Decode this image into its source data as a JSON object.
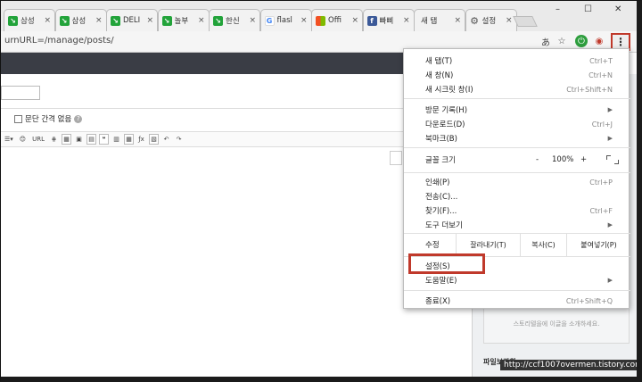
{
  "tabs": [
    {
      "title": "삼성",
      "icon": "green"
    },
    {
      "title": "삼성",
      "icon": "green"
    },
    {
      "title": "DELI",
      "icon": "green"
    },
    {
      "title": "놀부",
      "icon": "green"
    },
    {
      "title": "한신",
      "icon": "green"
    },
    {
      "title": "flasl",
      "icon": "g"
    },
    {
      "title": "Offi",
      "icon": "ms"
    },
    {
      "title": "빠삐",
      "icon": "fb"
    },
    {
      "title": "새 탭",
      "icon": "none"
    },
    {
      "title": "설정",
      "icon": "gear"
    }
  ],
  "tab_close": "×",
  "window": {
    "minimize": "–",
    "maximize": "☐",
    "close": "✕"
  },
  "address": {
    "url": "urnURL=/manage/posts/"
  },
  "editor": {
    "no_line_spacing_label": "문단 간격 없음",
    "help": "?"
  },
  "toolbar": [
    "☰▾",
    "😊",
    "URL",
    "⋕",
    "▦",
    "▣",
    "▤",
    "❝",
    "▥",
    "▦",
    "ƒx",
    "▧",
    "↶",
    "↷"
  ],
  "sidebar": {
    "promo": "스토리텔을에 이글을 소개하세요.",
    "file_section": "파일보관함"
  },
  "watermark": "http://ccf1007overmen.tistory.com",
  "menu": {
    "group1": [
      {
        "label": "새 탭(T)",
        "shortcut": "Ctrl+T"
      },
      {
        "label": "새 창(N)",
        "shortcut": "Ctrl+N"
      },
      {
        "label": "새 시크릿 창(I)",
        "shortcut": "Ctrl+Shift+N"
      }
    ],
    "group2": [
      {
        "label": "방문 기록(H)",
        "shortcut": "",
        "arrow": true
      },
      {
        "label": "다운로드(D)",
        "shortcut": "Ctrl+J"
      },
      {
        "label": "북마크(B)",
        "shortcut": "",
        "arrow": true
      }
    ],
    "zoom": {
      "label": "글꼴 크기",
      "minus": "-",
      "value": "100%",
      "plus": "+"
    },
    "group3": [
      {
        "label": "인쇄(P)",
        "shortcut": "Ctrl+P"
      },
      {
        "label": "전송(C)...",
        "shortcut": ""
      },
      {
        "label": "찾기(F)...",
        "shortcut": "Ctrl+F"
      },
      {
        "label": "도구 더보기",
        "shortcut": "",
        "arrow": true
      }
    ],
    "edit": {
      "label": "수정",
      "cut": "잘라내기(T)",
      "copy": "복사(C)",
      "paste": "붙여넣기(P)"
    },
    "group4": [
      {
        "label": "설정(S)",
        "shortcut": ""
      },
      {
        "label": "도움말(E)",
        "shortcut": "",
        "arrow": true
      }
    ],
    "exit": {
      "label": "종료(X)",
      "shortcut": "Ctrl+Shift+Q"
    }
  }
}
